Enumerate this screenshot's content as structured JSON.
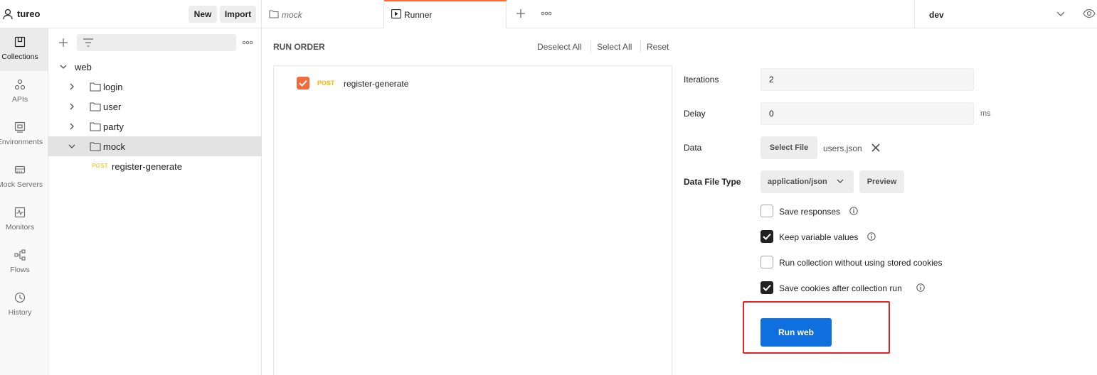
{
  "workspace": {
    "name": "tureo",
    "new_label": "New",
    "import_label": "Import"
  },
  "tabs": [
    {
      "label": "mock",
      "icon": "folder-icon",
      "active": false
    },
    {
      "label": "Runner",
      "icon": "runner-play-icon",
      "active": true
    }
  ],
  "environment": {
    "selected": "dev"
  },
  "rail": [
    {
      "label": "Collections",
      "icon": "collections-icon",
      "active": true
    },
    {
      "label": "APIs",
      "icon": "apis-icon"
    },
    {
      "label": "Environments",
      "icon": "environments-icon"
    },
    {
      "label": "Mock Servers",
      "icon": "mock-servers-icon"
    },
    {
      "label": "Monitors",
      "icon": "monitors-icon"
    },
    {
      "label": "Flows",
      "icon": "flows-icon"
    },
    {
      "label": "History",
      "icon": "history-icon"
    }
  ],
  "tree": {
    "collection": "web",
    "folders": [
      "login",
      "user",
      "party",
      "mock"
    ],
    "request": {
      "method": "POST",
      "name": "register-generate"
    }
  },
  "runner": {
    "run_order_title": "RUN ORDER",
    "deselect_all": "Deselect All",
    "select_all": "Select All",
    "reset": "Reset",
    "item": {
      "method": "POST",
      "name": "register-generate",
      "checked": true
    },
    "iterations_label": "Iterations",
    "iterations_value": "2",
    "delay_label": "Delay",
    "delay_value": "0",
    "delay_unit": "ms",
    "data_label": "Data",
    "select_file": "Select File",
    "file_name": "users.json",
    "data_file_type_label": "Data File Type",
    "data_file_type": "application/json",
    "preview": "Preview",
    "options": [
      {
        "label": "Save responses",
        "checked": false,
        "info": true
      },
      {
        "label": "Keep variable values",
        "checked": true,
        "info": true
      },
      {
        "label": "Run collection without using stored cookies",
        "checked": false,
        "info": false
      },
      {
        "label": "Save cookies after collection run",
        "checked": true,
        "info": true
      }
    ],
    "run_button": "Run web"
  },
  "colors": {
    "accent": "#ff6c37",
    "primary": "#0f6fde",
    "post": "#ffb400",
    "highlight": "#e02424"
  }
}
